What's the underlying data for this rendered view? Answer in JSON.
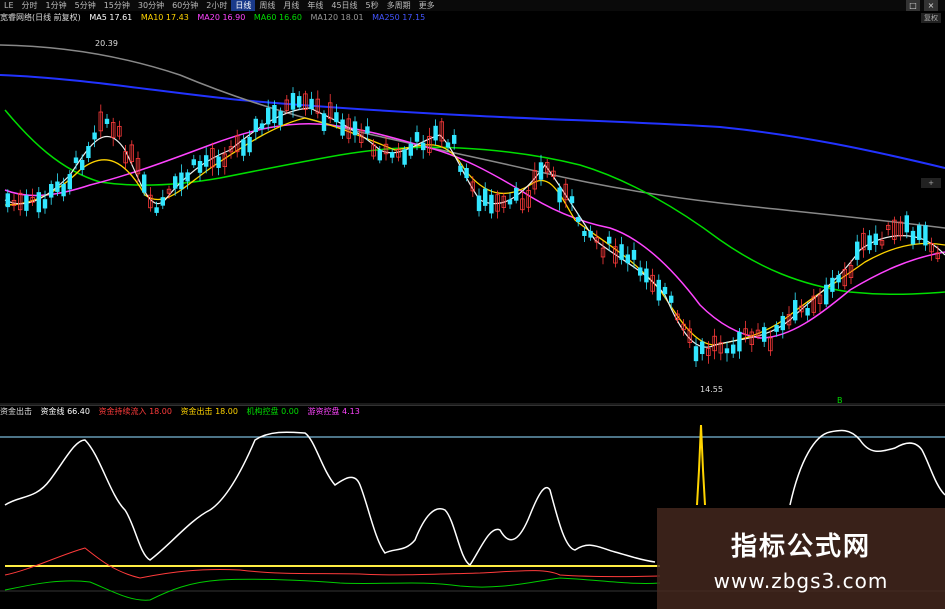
{
  "toolbar": {
    "items": [
      "LE",
      "分时",
      "1分钟",
      "5分钟",
      "15分钟",
      "30分钟",
      "60分钟",
      "2小时",
      "日线",
      "周线",
      "月线",
      "年线",
      "45日线",
      "5秒",
      "多周期",
      "更多"
    ],
    "active_index": 8
  },
  "window_buttons": [
    "□",
    "×"
  ],
  "side_buttons": [
    "复权",
    "+"
  ],
  "legend": {
    "prefix": "宽睿网络(日线 前复权)",
    "ma5": "MA5 17.61",
    "ma10": "MA10 17.43",
    "ma20": "MA20 16.90",
    "ma60": "MA60 16.60",
    "ma120": "MA120 18.01",
    "ma250": "MA250 17.15"
  },
  "price_labels": {
    "high": "20.39",
    "low": "14.55",
    "signal": "B"
  },
  "sub_header": {
    "name": "资金出击",
    "line1": "资金线 66.40",
    "line2": "资金持续流入 18.00",
    "line3": "资金出击 18.00",
    "line4": "机构控盘 0.00",
    "line5": "游资控盘 4.13"
  },
  "watermark": {
    "title": "指标公式网",
    "url": "www.zbgs3.com"
  },
  "colors": {
    "up": "#ff3b3b",
    "down": "#33e6ff",
    "ma5": "#ffffff",
    "ma10": "#ffd400",
    "ma20": "#ff44ff",
    "ma60": "#00dd00",
    "ma120": "#888888",
    "ma250": "#2233ff"
  }
}
